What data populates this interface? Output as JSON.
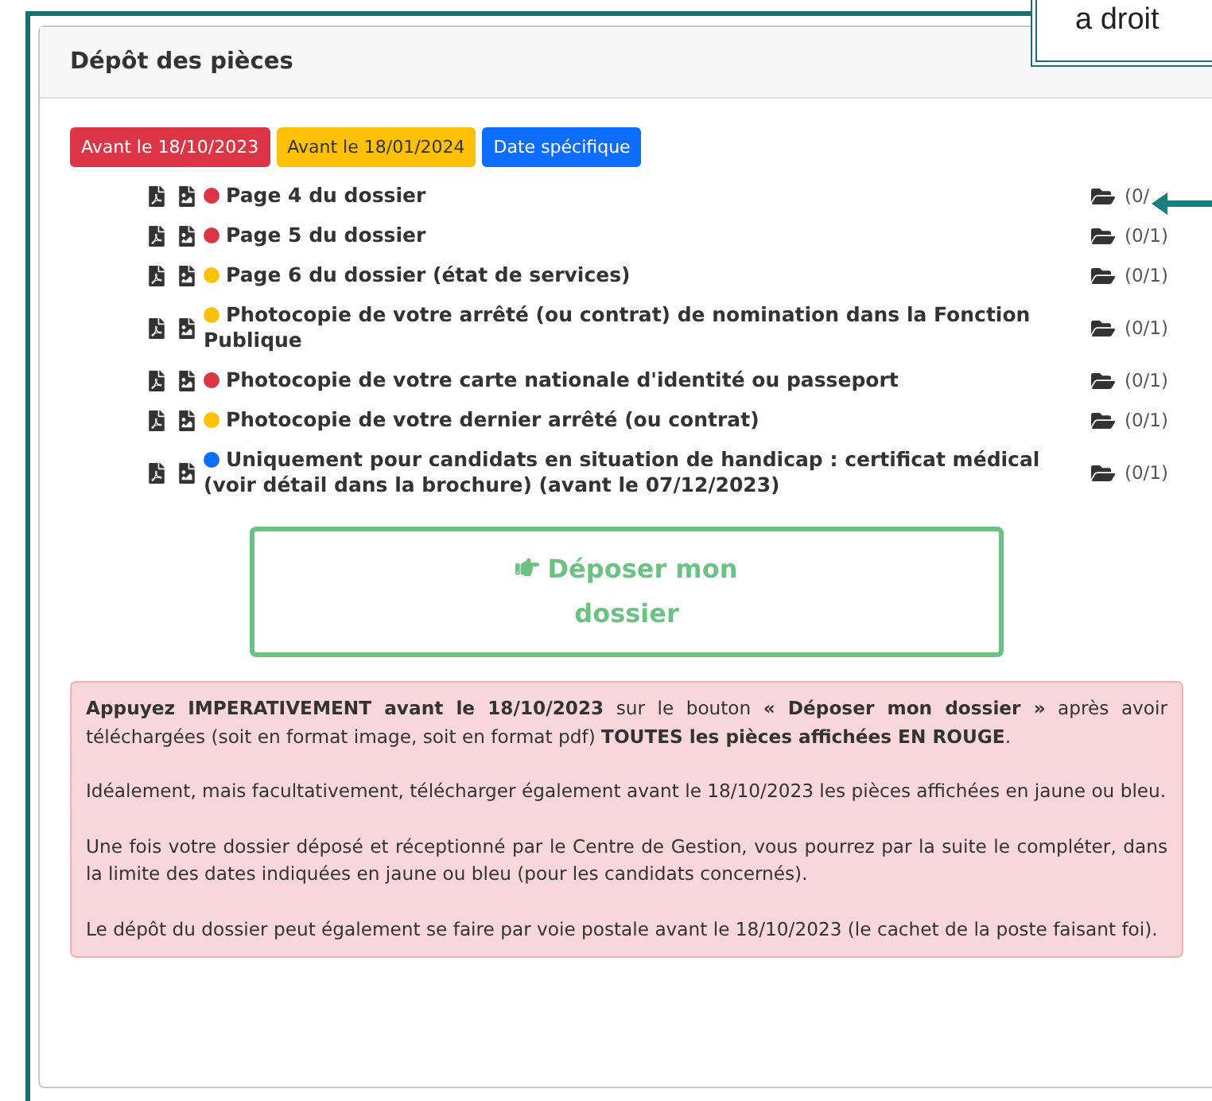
{
  "callout": {
    "text": "a droit"
  },
  "card": {
    "title": "Dépôt des pièces"
  },
  "badges": [
    {
      "label": "Avant le 18/10/2023",
      "color": "#dc3545"
    },
    {
      "label": "Avant le 18/01/2024",
      "color": "#ffc107"
    },
    {
      "label": "Date spécifique",
      "color": "#0d6efd"
    }
  ],
  "documents": [
    {
      "label": "Page 4 du dossier",
      "color": "#dc3545",
      "count": "(0/"
    },
    {
      "label": "Page 5 du dossier",
      "color": "#dc3545",
      "count": "(0/1)"
    },
    {
      "label": "Page 6 du dossier (état de services)",
      "color": "#ffc107",
      "count": "(0/1)"
    },
    {
      "label": "Photocopie de votre arrêté (ou contrat) de nomination dans la Fonction Publique",
      "color": "#ffc107",
      "count": "(0/1)"
    },
    {
      "label": "Photocopie de votre carte nationale d'identité ou passeport",
      "color": "#dc3545",
      "count": "(0/1)"
    },
    {
      "label": "Photocopie de votre dernier arrêté (ou contrat)",
      "color": "#ffc107",
      "count": "(0/1)"
    },
    {
      "label": "Uniquement pour candidats en situation de handicap : certificat médical (voir détail dans la brochure) (avant le 07/12/2023)",
      "color": "#0d6efd",
      "count": "(0/1)"
    }
  ],
  "submit_button": {
    "label": "Déposer mon dossier"
  },
  "alert": {
    "paragraphs": [
      "**Appuyez IMPERATIVEMENT avant le 18/10/2023** sur le bouton **« Déposer mon dossier »** après avoir téléchargées (soit en format image, soit en format pdf) **TOUTES les pièces affichées EN ROUGE**.",
      "Idéalement, mais facultativement, télécharger également avant le 18/10/2023 les pièces affichées en jaune ou bleu.",
      "Une fois votre dossier déposé et réceptionné par le Centre de Gestion, vous pourrez par la suite le compléter, dans la limite des dates indiquées en jaune ou bleu (pour les candidats concernés).",
      "Le dépôt du dossier peut également se faire par voie postale avant le 18/10/2023 (le cachet de la poste faisant foi)."
    ]
  }
}
